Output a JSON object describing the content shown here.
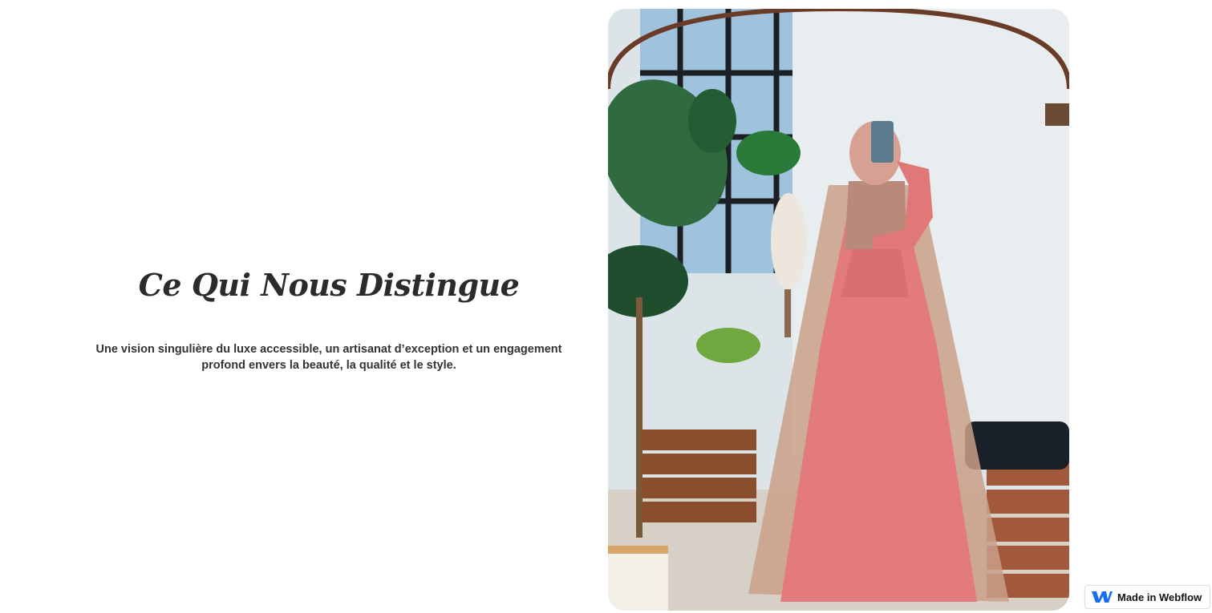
{
  "section": {
    "heading": "Ce Qui Nous Distingue",
    "description": "Une vision singulière du luxe accessible, un artisanat d’exception et un engagement profond envers la beauté, la qualité et le style."
  },
  "photo": {
    "subject": "woman-in-pink-gown-mirror-selfie"
  },
  "badge": {
    "label": "Made in Webflow",
    "icon": "webflow-logo-icon",
    "accent": "#146ef5"
  },
  "colors": {
    "heading": "#2b2b2b",
    "text": "#333333",
    "background": "#ffffff"
  }
}
